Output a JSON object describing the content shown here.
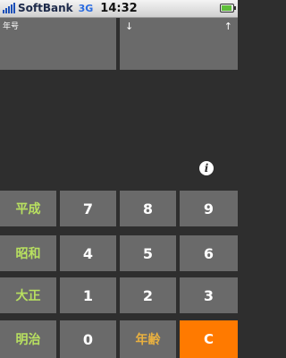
{
  "status_bar": {
    "carrier": "SoftBank",
    "network": "3G",
    "time": "14:32",
    "battery_level": 0.9
  },
  "display": {
    "era_label": "年号",
    "arrow_down": "↓",
    "arrow_up": "↑"
  },
  "info_button": {
    "glyph": "i",
    "icon": "info-icon"
  },
  "keys": {
    "era_heisei": "平成",
    "era_showa": "昭和",
    "era_taisho": "大正",
    "era_meiji": "明治",
    "n7": "7",
    "n8": "8",
    "n9": "9",
    "n4": "4",
    "n5": "5",
    "n6": "6",
    "n1": "1",
    "n2": "2",
    "n3": "3",
    "n0": "0",
    "age": "年齢",
    "clear": "C"
  },
  "colors": {
    "background": "#2e2e2e",
    "key": "#6a6a6a",
    "era_text": "#b8e060",
    "age_text": "#e8b040",
    "clear_key": "#ff7a00"
  }
}
